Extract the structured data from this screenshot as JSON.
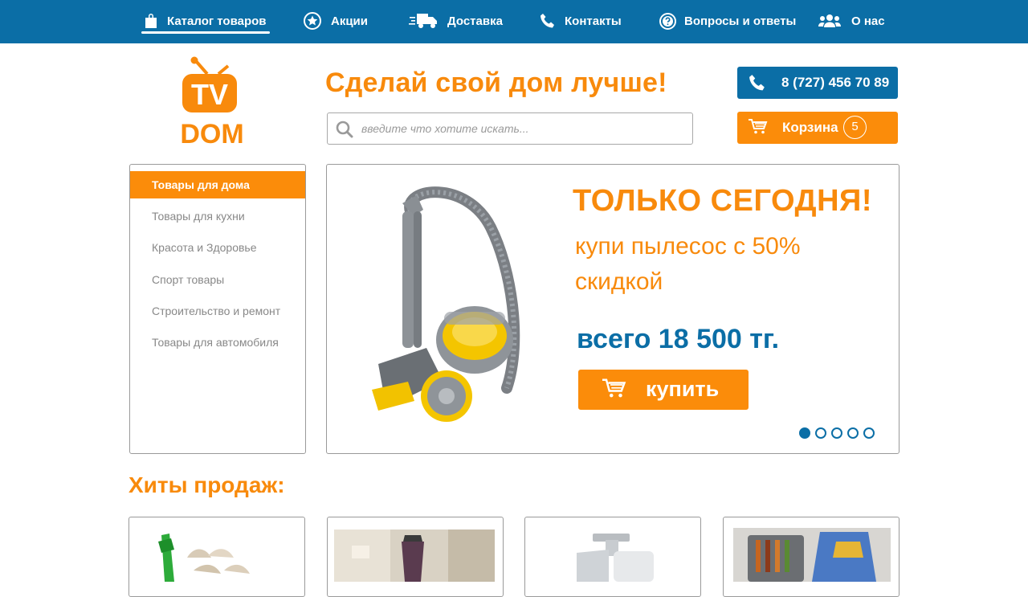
{
  "nav": {
    "items": [
      {
        "label": "Каталог товаров",
        "icon": "shopping-bag-icon"
      },
      {
        "label": "Акции",
        "icon": "star-badge-icon"
      },
      {
        "label": "Доставка",
        "icon": "truck-icon"
      },
      {
        "label": "Контакты",
        "icon": "phone-icon"
      },
      {
        "label": "Вопросы и ответы",
        "icon": "question-icon"
      },
      {
        "label": "О нас",
        "icon": "users-icon"
      }
    ]
  },
  "logo": {
    "line1": "TV",
    "line2": "DOM"
  },
  "header": {
    "slogan": "Сделай свой дом лучше!",
    "search_placeholder": "введите что хотите искать...",
    "phone": "8 (727) 456 70 89",
    "cart_label": "Корзина",
    "cart_count": "5"
  },
  "sidebar": {
    "items": [
      {
        "label": "Товары для дома",
        "active": true
      },
      {
        "label": "Товары для кухни",
        "active": false
      },
      {
        "label": "Красота и Здоровье",
        "active": false
      },
      {
        "label": "Спорт товары",
        "active": false
      },
      {
        "label": "Строительство и ремонт",
        "active": false
      },
      {
        "label": "Товары для автомобиля",
        "active": false
      }
    ]
  },
  "banner": {
    "title": "ТОЛЬКО СЕГОДНЯ!",
    "subtitle": "купи пылесос с 50% скидкой",
    "price": "всего 18 500 тг.",
    "buy_label": "купить",
    "slides": 5,
    "active_slide": 1
  },
  "hits": {
    "title": "Хиты продаж:"
  },
  "colors": {
    "brand_blue": "#0b6ea6",
    "brand_orange": "#fb8c0a"
  }
}
